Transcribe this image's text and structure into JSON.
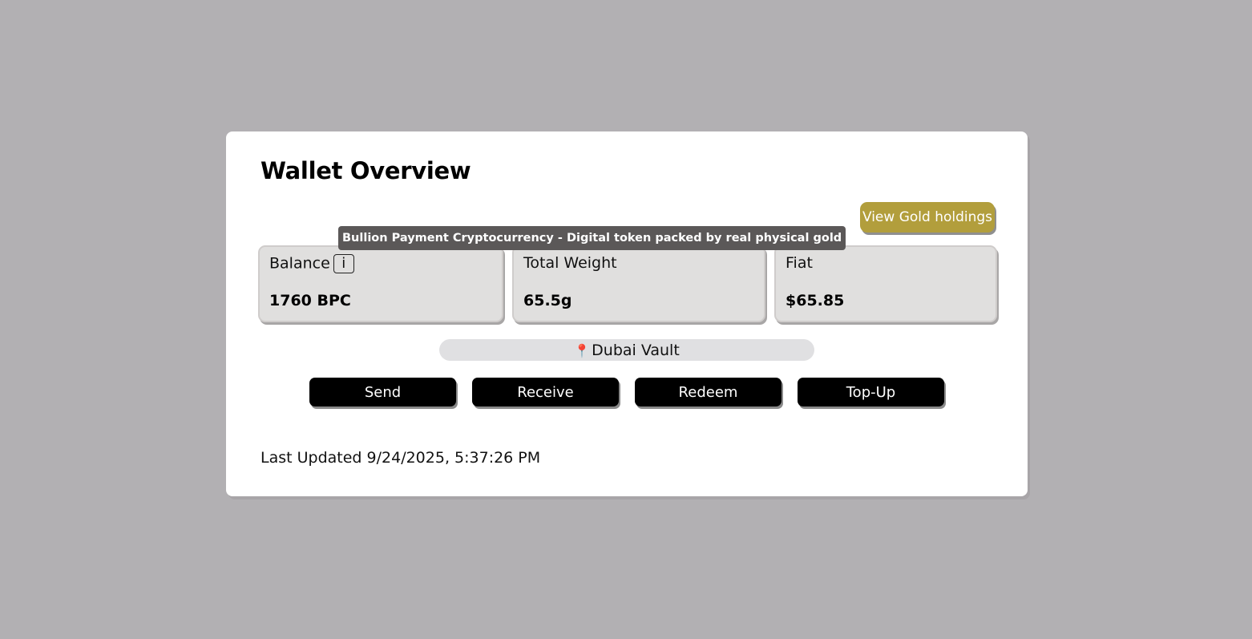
{
  "header": {
    "title": "Wallet Overview"
  },
  "gold_button": {
    "label": "View Gold holdings"
  },
  "tooltip": {
    "text": "Bullion Payment Cryptocurrency - Digital token packed by real physical gold"
  },
  "stats": {
    "balance": {
      "label": "Balance",
      "info": "i",
      "value": "1760 BPC"
    },
    "weight": {
      "label": "Total Weight",
      "value": "65.5g"
    },
    "fiat": {
      "label": "Fiat",
      "value": "$65.85"
    }
  },
  "location": {
    "icon": "pin-icon",
    "name": "Dubai Vault"
  },
  "actions": {
    "send": "Send",
    "receive": "Receive",
    "redeem": "Redeem",
    "topup": "Top-Up"
  },
  "footer": {
    "updated": "Last Updated 9/24/2025, 5:37:26 PM"
  },
  "colors": {
    "gold": "#b29e3c",
    "tooltip_bg": "#5b5858",
    "background": "#b2b0b3"
  }
}
